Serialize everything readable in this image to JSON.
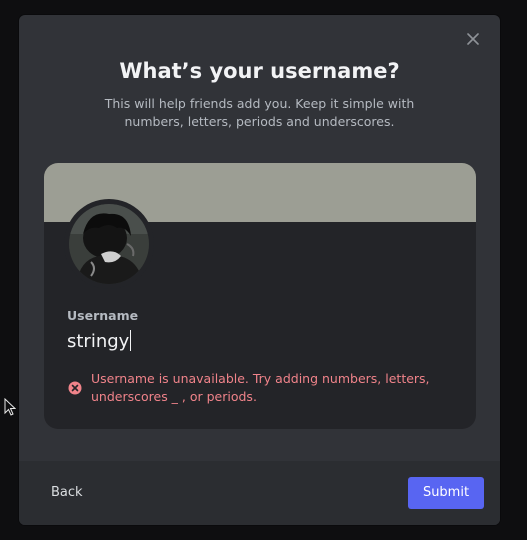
{
  "modal": {
    "title": "What’s your username?",
    "subtitle": "This will help friends add you. Keep it simple with numbers, letters, periods and underscores."
  },
  "profile": {
    "banner_color": "#9c9e94",
    "avatar_icon": "user-avatar"
  },
  "username_field": {
    "label": "Username",
    "value": "stringy"
  },
  "error": {
    "icon": "error-circle-icon",
    "message": "Username is unavailable. Try adding numbers, letters, underscores _ , or periods."
  },
  "footer": {
    "back_label": "Back",
    "submit_label": "Submit"
  },
  "colors": {
    "accent": "#5865f2",
    "error": "#f0838a",
    "modal_bg": "#313338",
    "card_bg": "#232428"
  }
}
